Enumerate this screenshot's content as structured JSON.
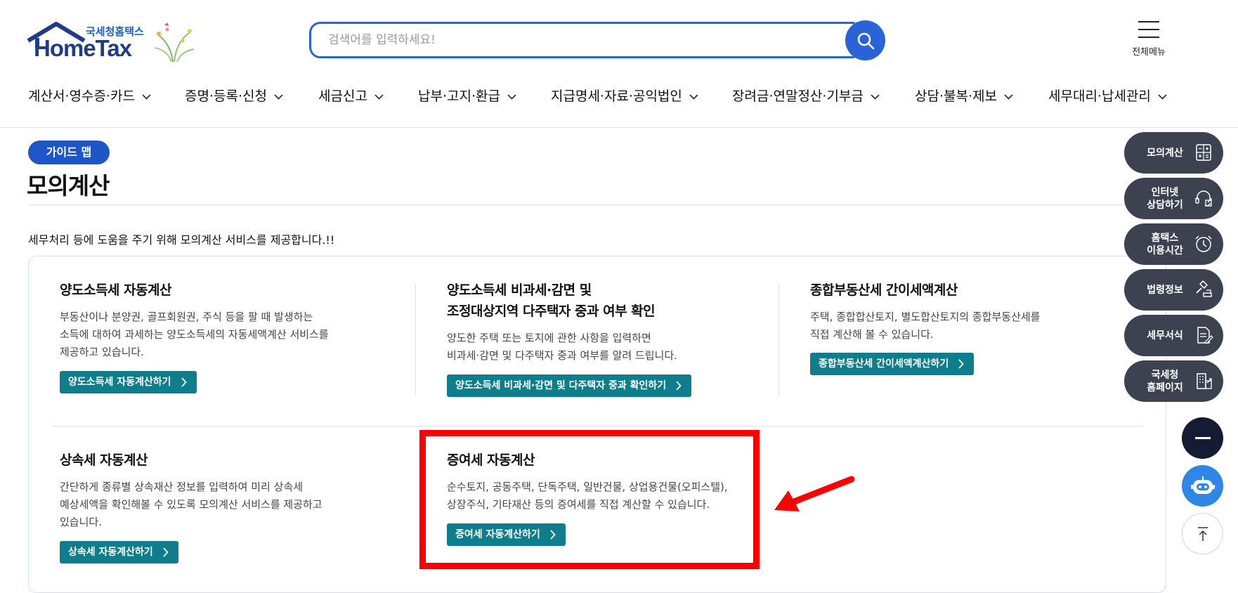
{
  "header": {
    "logo_small": "국세청홈택스",
    "logo_big": "HomeTax",
    "search_placeholder": "검색어를 입력하세요!",
    "all_menu_label": "전체메뉴"
  },
  "nav": [
    "계산서·영수증·카드",
    "증명·등록·신청",
    "세금신고",
    "납부·고지·환급",
    "지급명세·자료·공익법인",
    "장려금·연말정산·기부금",
    "상담·불복·제보",
    "세무대리·납세관리"
  ],
  "page": {
    "badge": "가이드 맵",
    "title": "모의계산",
    "intro": "세무처리 등에 도움을 주기 위해 모의계산 서비스를 제공합니다.!!"
  },
  "cards": [
    {
      "title": [
        "양도소득세 자동계산"
      ],
      "desc": [
        "부동산이나 분양권, 골프회원권, 주식 등을 팔 때 발생하는",
        "소득에 대하여 과세하는 양도소득세의 자동세액계산 서비스를",
        "제공하고 있습니다."
      ],
      "button": "양도소득세 자동계산하기"
    },
    {
      "title": [
        "양도소득세 비과세·감면 및",
        "조정대상지역 다주택자 중과 여부 확인"
      ],
      "desc": [
        "양도한 주택 또는 토지에 관한 사항을 입력하면",
        "비과세·감면 및 다주택자 중과 여부를 알려 드립니다."
      ],
      "button": "양도소득세 비과세·감면 및 다주택자 중과 확인하기"
    },
    {
      "title": [
        "종합부동산세 간이세액계산"
      ],
      "desc": [
        "주택, 종합합산토지, 별도합산토지의 종합부동산세를",
        "직접 계산해 볼 수 있습니다."
      ],
      "button": "종합부동산세 간이세액계산하기"
    },
    {
      "title": [
        "상속세 자동계산"
      ],
      "desc": [
        "간단하게 종류별 상속재산 정보를 입력하여 미리 상속세",
        "예상세액을 확인해볼 수 있도록 모의계산 서비스를 제공하고",
        "있습니다."
      ],
      "button": "상속세 자동계산하기"
    },
    {
      "title": [
        "증여세 자동계산"
      ],
      "desc": [
        "순수토지, 공동주택, 단독주택, 일반건물, 상업용건물(오피스텔),",
        "상장주식, 기타재산 등의 증여세를 직접 계산할 수 있습니다."
      ],
      "button": "증여세 자동계산하기"
    }
  ],
  "quick_menu": [
    {
      "label": [
        "모의계산"
      ],
      "icon": "calculator-icon"
    },
    {
      "label": [
        "인터넷",
        "상담하기"
      ],
      "icon": "headset-icon"
    },
    {
      "label": [
        "홈택스",
        "이용시간"
      ],
      "icon": "alarm-clock-icon"
    },
    {
      "label": [
        "법령정보"
      ],
      "icon": "gavel-icon"
    },
    {
      "label": [
        "세무서식"
      ],
      "icon": "document-icon"
    },
    {
      "label": [
        "국세청",
        "홈페이지"
      ],
      "icon": "building-icon"
    }
  ],
  "colors": {
    "brand_blue": "#2a63d8",
    "badge_blue": "#1f56c7",
    "teal_button": "#0e7d8c",
    "quick_bg": "#3c4250",
    "highlight_red": "#ff0000",
    "chatbot_blue": "#2e86e6"
  }
}
